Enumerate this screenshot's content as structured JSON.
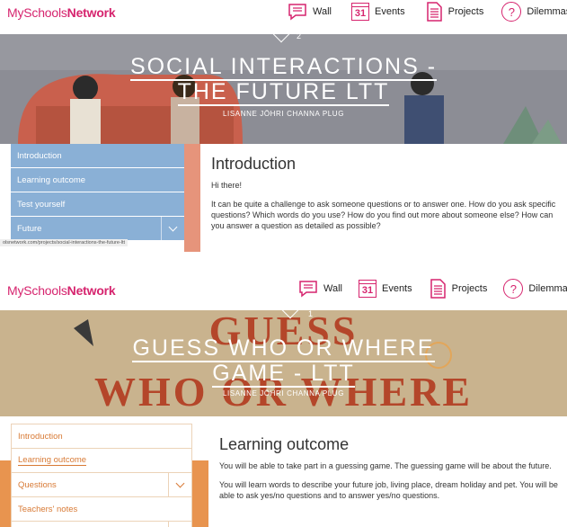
{
  "logo": {
    "prefix": "MySchools",
    "bold": "Network"
  },
  "nav": {
    "wall": "Wall",
    "events_day": "31",
    "events": "Events",
    "projects": "Projects",
    "dilemmas": "Dilemmas"
  },
  "panel1": {
    "counter": "2",
    "title_line1": "SOCIAL INTERACTIONS -",
    "title_line2": "THE FUTURE LTT",
    "authors": "LISANNE JÖHRI  CHANNA PLUG",
    "menu": [
      "Introduction",
      "Learning outcome",
      "Test yourself",
      "Future"
    ],
    "url": "olsnetwork.com/projects/social-interactions-the-future-ltt",
    "heading": "Introduction",
    "paragraphs": [
      "Hi there!",
      "It can be quite a challenge to ask someone questions or to answer one. How do you ask specific questions? Which words do you use? How do you find out more about someone else? How can you answer a question as detailed as possible?"
    ]
  },
  "panel2": {
    "counter": "1",
    "title_line1": "GUESS WHO OR WHERE",
    "title_line2": "GAME - LTT",
    "authors": "LISANNE JÖHRI  CHANNA PLUG",
    "bg_words": [
      "GUESS",
      "WHO OR WHERE"
    ],
    "menu": [
      "Introduction",
      "Learning outcome",
      "Questions",
      "Teachers' notes"
    ],
    "heading": "Learning outcome",
    "paragraphs": [
      "You will be  able to take part in a guessing game. The guessing game will be about the future.",
      "You will learn words to describe your future job, living place, dream holiday and pet. You will be able to ask yes/no questions and to answer yes/no questions."
    ]
  },
  "colors": {
    "brand": "#d6246e",
    "menu_blue": "#8ab0d6",
    "menu_orange": "#e8944f",
    "hero1": "#8d8e95",
    "hero2": "#c9b38f"
  }
}
